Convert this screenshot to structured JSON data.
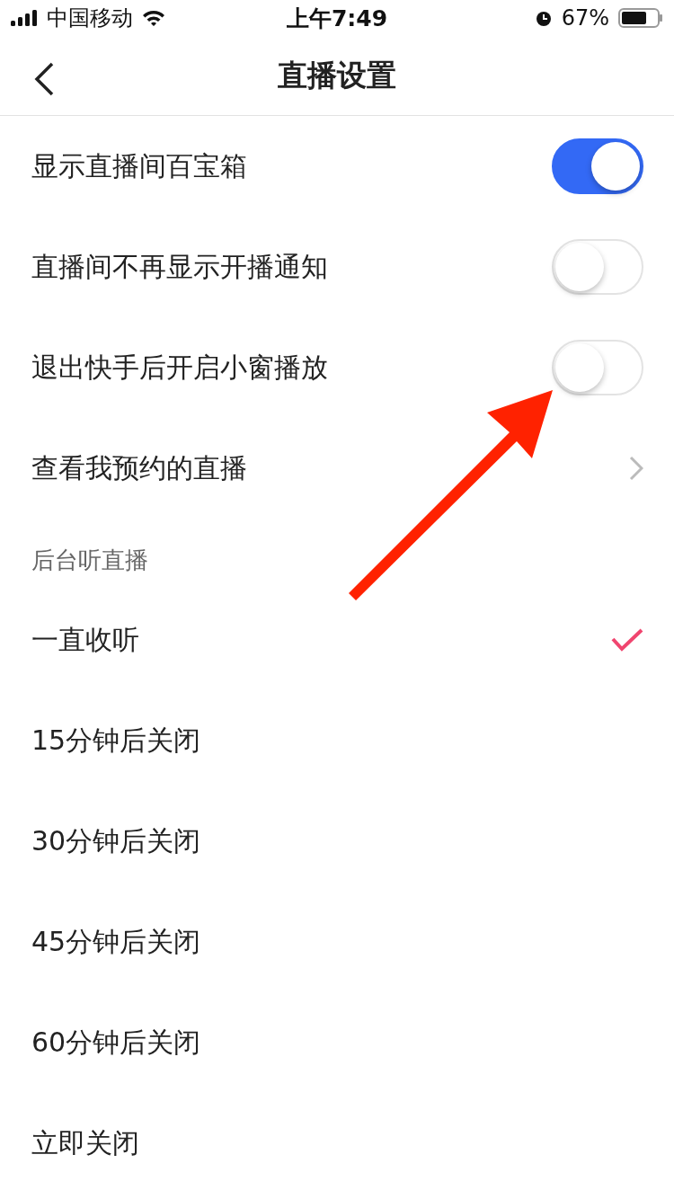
{
  "status_bar": {
    "carrier": "中国移动",
    "time": "上午7:49",
    "battery": "67%"
  },
  "nav": {
    "title": "直播设置"
  },
  "settings": [
    {
      "kind": "toggle",
      "label": "显示直播间百宝箱",
      "on": true
    },
    {
      "kind": "toggle",
      "label": "直播间不再显示开播通知",
      "on": false
    },
    {
      "kind": "toggle",
      "label": "退出快手后开启小窗播放",
      "on": false
    },
    {
      "kind": "link",
      "label": "查看我预约的直播"
    }
  ],
  "section": {
    "title": "后台听直播",
    "options": [
      {
        "label": "一直收听",
        "selected": true
      },
      {
        "label": "15分钟后关闭",
        "selected": false
      },
      {
        "label": "30分钟后关闭",
        "selected": false
      },
      {
        "label": "45分钟后关闭",
        "selected": false
      },
      {
        "label": "60分钟后关闭",
        "selected": false
      },
      {
        "label": "立即关闭",
        "selected": false
      }
    ]
  }
}
